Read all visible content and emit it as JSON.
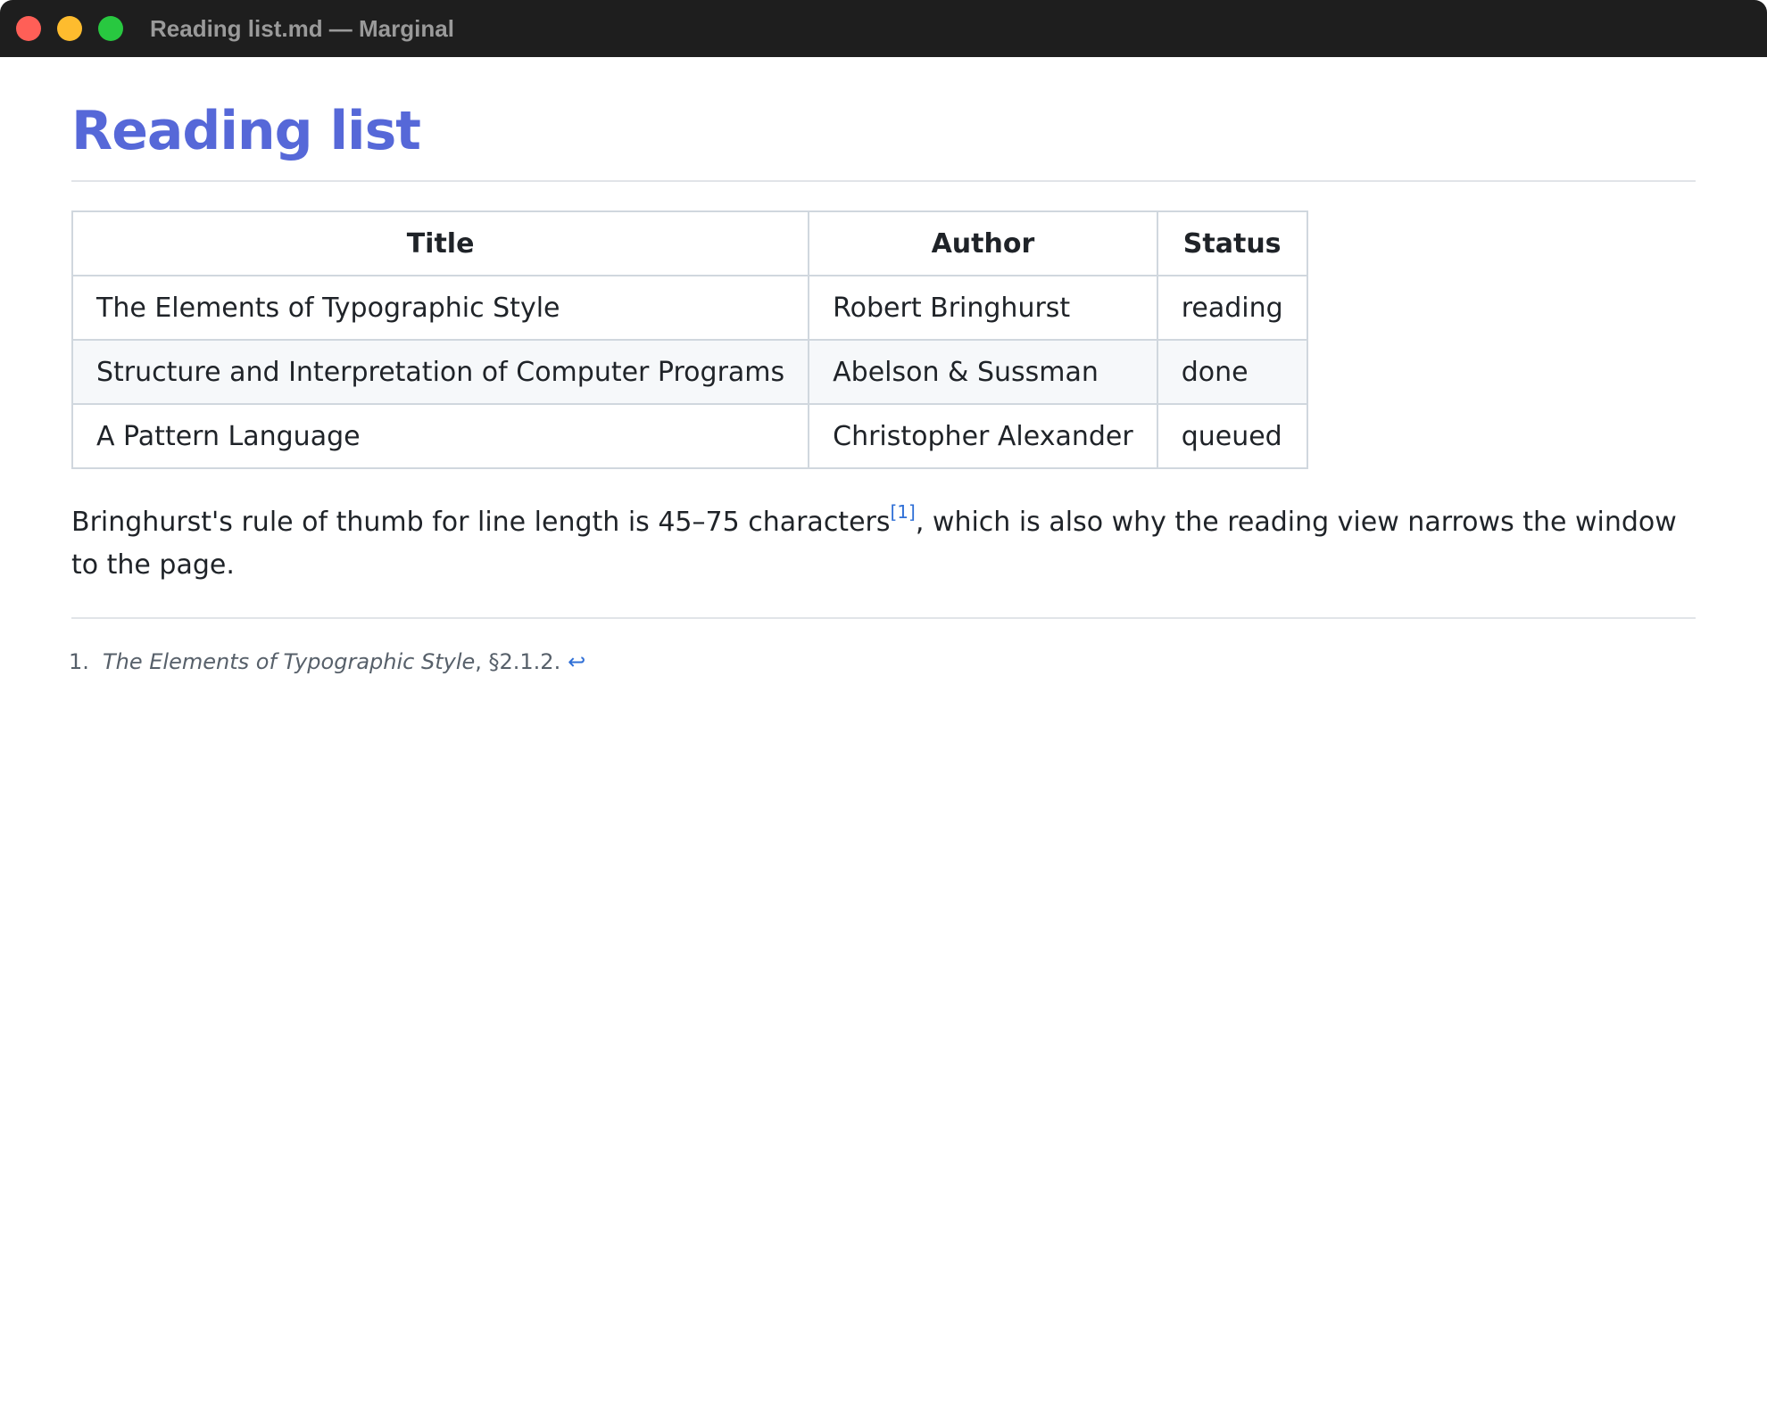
{
  "window": {
    "title": "Reading list.md — Marginal"
  },
  "document": {
    "heading": "Reading list",
    "table": {
      "headers": [
        "Title",
        "Author",
        "Status"
      ],
      "rows": [
        [
          "The Elements of Typographic Style",
          "Robert Bringhurst",
          "reading"
        ],
        [
          "Structure and Interpretation of Computer Programs",
          "Abelson & Sussman",
          "done"
        ],
        [
          "A Pattern Language",
          "Christopher Alexander",
          "queued"
        ]
      ]
    },
    "paragraph": {
      "before": "Bringhurst's rule of thumb for line length is 45–75 characters",
      "footnote_ref": "[1]",
      "after": ", which is also why the reading view narrows the window to the page."
    },
    "footnotes": [
      {
        "number": "1.",
        "title": "The Elements of Typographic Style",
        "rest": ", §2.1.2.",
        "backref": "↩"
      }
    ]
  },
  "colors": {
    "heading": "#5668d8",
    "link": "#2f6fd6",
    "titlebar": "#1e1e1e",
    "close": "#ff5f57",
    "minimize": "#febc2e",
    "zoom": "#28c840"
  }
}
